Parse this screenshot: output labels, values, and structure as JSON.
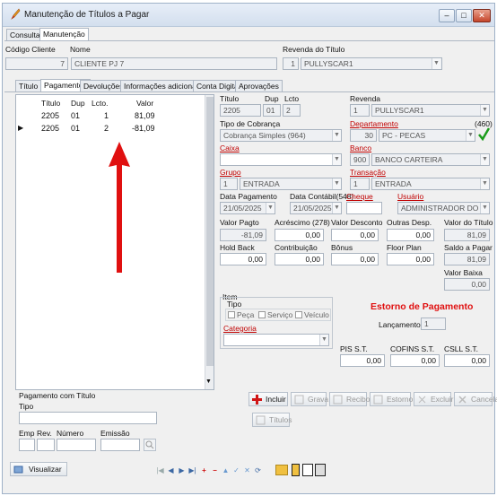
{
  "window": {
    "title": "Manutenção de Títulos a Pagar",
    "controls": [
      "minimize",
      "maximize",
      "close"
    ]
  },
  "top_tabs": [
    "Consulta",
    "Manutenção"
  ],
  "header": {
    "codigo_cliente_label": "Código Cliente",
    "nome_label": "Nome",
    "codigo_cliente": "7",
    "nome": "CLIENTE PJ 7",
    "revenda_label": "Revenda do Título",
    "revenda_code": "1",
    "revenda_name": "PULLYSCAR1"
  },
  "sub_tabs": [
    "Título",
    "Pagamentos",
    "Devoluções",
    "Informações adicionais",
    "Conta Digital",
    "Aprovações"
  ],
  "grid": {
    "columns": [
      "Título",
      "Dup",
      "Lcto.",
      "Valor"
    ],
    "rows": [
      {
        "titulo": "2205",
        "dup": "01",
        "lcto": "1",
        "valor": "81,09"
      },
      {
        "titulo": "2205",
        "dup": "01",
        "lcto": "2",
        "valor": "-81,09"
      }
    ]
  },
  "form": {
    "titulo_label": "Título",
    "dup_label": "Dup",
    "lcto_label": "Lcto",
    "titulo": "2205",
    "dup": "01",
    "lcto": "2",
    "revenda_label": "Revenda",
    "revenda_code": "1",
    "revenda_name": "PULLYSCAR1",
    "tipo_cobranca_label": "Tipo de Cobrança",
    "tipo_cobranca": "Cobrança Simples (964)",
    "departamento_label": "Departamento",
    "departamento_count": "(460)",
    "departamento_code": "30",
    "departamento_name": "PC - PECAS",
    "caixa_label": "Caixa",
    "banco_label": "Banco",
    "banco_code": "900",
    "banco_name": "BANCO CARTEIRA",
    "grupo_label": "Grupo",
    "grupo_code": "1",
    "grupo_name": "ENTRADA",
    "transacao_label": "Transação",
    "transacao_code": "1",
    "transacao_name": "ENTRADA",
    "data_pagamento_label": "Data Pagamento",
    "data_pagamento": "21/05/2025",
    "data_contabil_label": "Data Contábil(548)",
    "data_contabil": "21/05/2025",
    "cheque_label": "Cheque",
    "usuario_label": "Usuário",
    "usuario": "ADMINISTRADOR DO SISTEMA",
    "valor_pagto_label": "Valor Pagto",
    "valor_pagto": "-81,09",
    "acrescimo_label": "Acréscimo (278)",
    "acrescimo": "0,00",
    "valor_desconto_label": "Valor Desconto",
    "valor_desconto": "0,00",
    "outras_desp_label": "Outras Desp.",
    "outras_desp": "0,00",
    "valor_titulo_label": "Valor do Título",
    "valor_titulo": "81,09",
    "hold_back_label": "Hold Back",
    "hold_back": "0,00",
    "contribuicao_label": "Contribuição",
    "contribuicao": "0,00",
    "bonus_label": "Bônus",
    "bonus": "0,00",
    "floor_plan_label": "Floor Plan",
    "floor_plan": "0,00",
    "saldo_pagar_label": "Saldo a Pagar",
    "saldo_pagar": "81,09",
    "valor_baixa_label": "Valor Baixa",
    "valor_baixa": "0,00",
    "item_label": "Item",
    "tipo_label": "Tipo",
    "tipo_options": [
      "Peça",
      "Serviço",
      "Veículo"
    ],
    "categoria_label": "Categoria",
    "estorno_title": "Estorno de Pagamento",
    "lancamentos_label": "Lançamentos:",
    "lancamentos": "1",
    "pis_label": "PIS S.T.",
    "pis": "0,00",
    "cofins_label": "COFINS S.T.",
    "cofins": "0,00",
    "csll_label": "CSLL S.T.",
    "csll": "0,00"
  },
  "pagamento_titulo": {
    "group_label": "Pagamento com Título",
    "tipo_label": "Tipo",
    "emp_label": "Emp",
    "rev_label": "Rev.",
    "numero_label": "Número",
    "emissao_label": "Emissão"
  },
  "actions": {
    "incluir": "Incluir",
    "gravar": "Grava",
    "recibo": "Recibo",
    "estorno": "Estorno",
    "excluir": "Excluir",
    "cancelar": "Cancela",
    "titulos": "Títulos"
  },
  "bottom": {
    "visualizar": "Visualizar"
  },
  "colors": {
    "accent_red": "#e01010",
    "label_red": "#c00000",
    "check_green": "#1a9b1a"
  }
}
